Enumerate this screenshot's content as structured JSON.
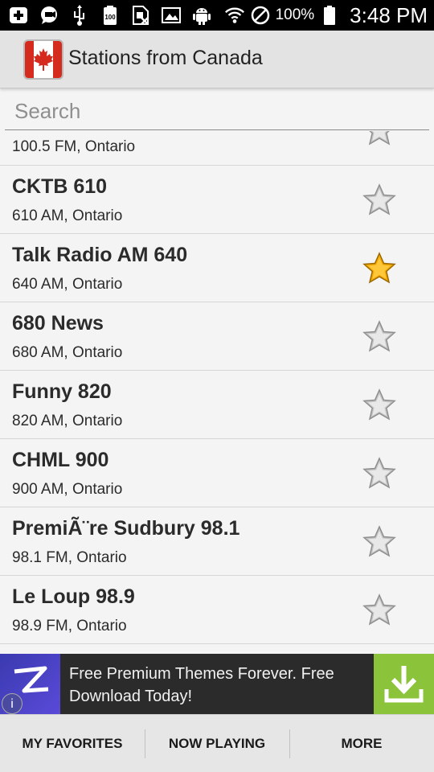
{
  "status_bar": {
    "battery_percent": "100%",
    "time": "3:48 PM"
  },
  "app_bar": {
    "title": "Stations from Canada",
    "icon": "canada-flag-icon"
  },
  "search": {
    "placeholder": "Search",
    "value": ""
  },
  "stations": [
    {
      "name": "",
      "subtitle": "100.5 FM, Ontario",
      "favorite": false
    },
    {
      "name": "CKTB 610",
      "subtitle": "610 AM, Ontario",
      "favorite": false
    },
    {
      "name": "Talk Radio AM 640",
      "subtitle": "640 AM, Ontario",
      "favorite": true
    },
    {
      "name": "680 News",
      "subtitle": "680 AM, Ontario",
      "favorite": false
    },
    {
      "name": "Funny 820",
      "subtitle": "820 AM, Ontario",
      "favorite": false
    },
    {
      "name": "CHML 900",
      "subtitle": "900 AM, Ontario",
      "favorite": false
    },
    {
      "name": "PremiÃ¨re Sudbury 98.1",
      "subtitle": "98.1 FM, Ontario",
      "favorite": false
    },
    {
      "name": "Le Loup 98.9",
      "subtitle": "98.9 FM, Ontario",
      "favorite": false
    }
  ],
  "ad": {
    "text": "Free Premium Themes Forever. Free Download Today!",
    "info_icon": "info-icon",
    "download_icon": "download-icon"
  },
  "bottom_nav": {
    "favorites": "MY FAVORITES",
    "now_playing": "NOW PLAYING",
    "more": "MORE"
  },
  "colors": {
    "star_active": "#f5a800",
    "star_inactive": "#b9b9b9",
    "ad_download_bg": "#8bc33b"
  }
}
